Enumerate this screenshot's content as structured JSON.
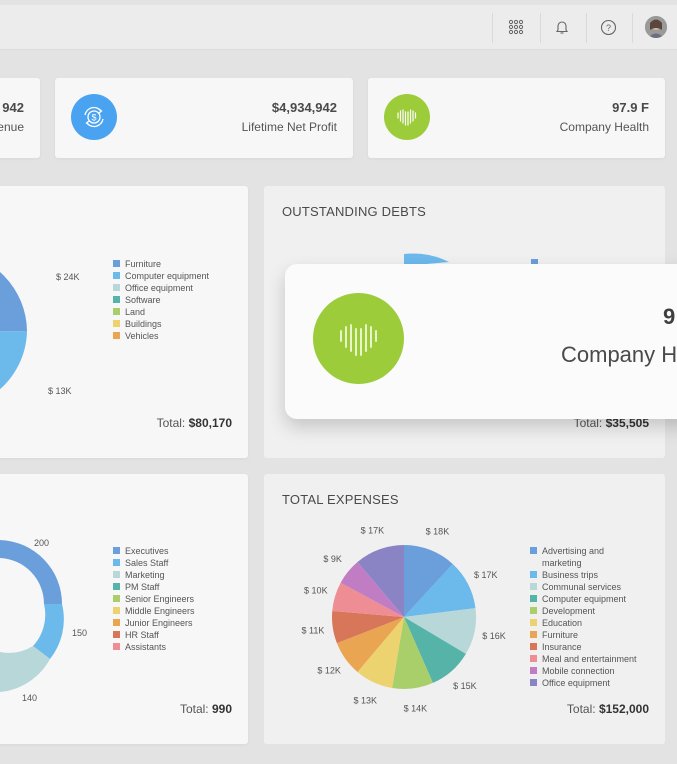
{
  "topbar": {
    "icons": [
      "apps-grid-icon",
      "bell-icon",
      "help-icon",
      "user-avatar"
    ]
  },
  "stats": [
    {
      "value": "942",
      "label": "enue",
      "icon": "none"
    },
    {
      "value": "$4,934,942",
      "label": "Lifetime Net Profit",
      "icon": "exchange-dollar-icon",
      "color": "#4aa3f0"
    },
    {
      "value": "97.9 F",
      "label": "Company Health",
      "icon": "heart-bars-icon",
      "color": "#9ccc3a"
    }
  ],
  "assets_panel": {
    "legend": [
      "Furniture",
      "Computer equipment",
      "Office equipment",
      "Software",
      "Land",
      "Buildings",
      "Vehicles"
    ],
    "colors": [
      "#6a9fdb",
      "#6cb9ec",
      "#b7d7d8",
      "#55b3a8",
      "#a9cf6b",
      "#ecd36f",
      "#eaa552"
    ],
    "labels": [
      "$ 24K",
      "$ 13K"
    ],
    "total_label": "Total:",
    "total_value": "$80,170"
  },
  "debts_panel": {
    "title": "OUTSTANDING DEBTS",
    "total_label": "Total:",
    "total_value": "$35,505"
  },
  "staff_panel": {
    "legend": [
      "Executives",
      "Sales Staff",
      "Marketing",
      "PM Staff",
      "Senior Engineers",
      "Middle Engineers",
      "Junior Engineers",
      "HR Staff",
      "Assistants"
    ],
    "colors": [
      "#6a9fdb",
      "#6cb9ec",
      "#b7d7d8",
      "#55b3a8",
      "#a9cf6b",
      "#ecd36f",
      "#eaa552",
      "#d8765a",
      "#ee8e94"
    ],
    "labels": [
      "200",
      "150",
      "140"
    ],
    "total_label": "Total:",
    "total_value": "990"
  },
  "expenses_panel": {
    "title": "TOTAL EXPENSES",
    "legend": [
      "Advertising and marketing",
      "Business trips",
      "Communal services",
      "Computer equipment",
      "Development",
      "Education",
      "Furniture",
      "Insurance",
      "Meal and entertainment",
      "Mobile connection",
      "Office equipment"
    ],
    "colors": [
      "#6a9fdb",
      "#6cb9ec",
      "#b7d7d8",
      "#55b3a8",
      "#a9cf6b",
      "#ecd36f",
      "#eaa552",
      "#d8765a",
      "#ee8e94",
      "#c07dc4",
      "#8a84c4"
    ],
    "labels": [
      "$ 18K",
      "$ 17K",
      "$ 16K",
      "$ 15K",
      "$ 14K",
      "$ 13K",
      "$ 12K",
      "$ 11K",
      "$ 10K",
      "$ 9K",
      "$ 17K"
    ],
    "total_label": "Total:",
    "total_value": "$152,000"
  },
  "popup": {
    "value": "9",
    "label": "Company H",
    "icon": "heart-bars-icon",
    "color": "#9ccc3a"
  },
  "chart_data": [
    {
      "type": "pie",
      "title": "TOTAL EXPENSES",
      "categories": [
        "Advertising and marketing",
        "Business trips",
        "Communal services",
        "Computer equipment",
        "Development",
        "Education",
        "Furniture",
        "Insurance",
        "Meal and entertainment",
        "Mobile connection",
        "Office equipment"
      ],
      "values": [
        18,
        17,
        16,
        15,
        14,
        13,
        12,
        11,
        10,
        9,
        17
      ],
      "unit": "$K",
      "total": "$152,000",
      "legend": "right"
    }
  ]
}
